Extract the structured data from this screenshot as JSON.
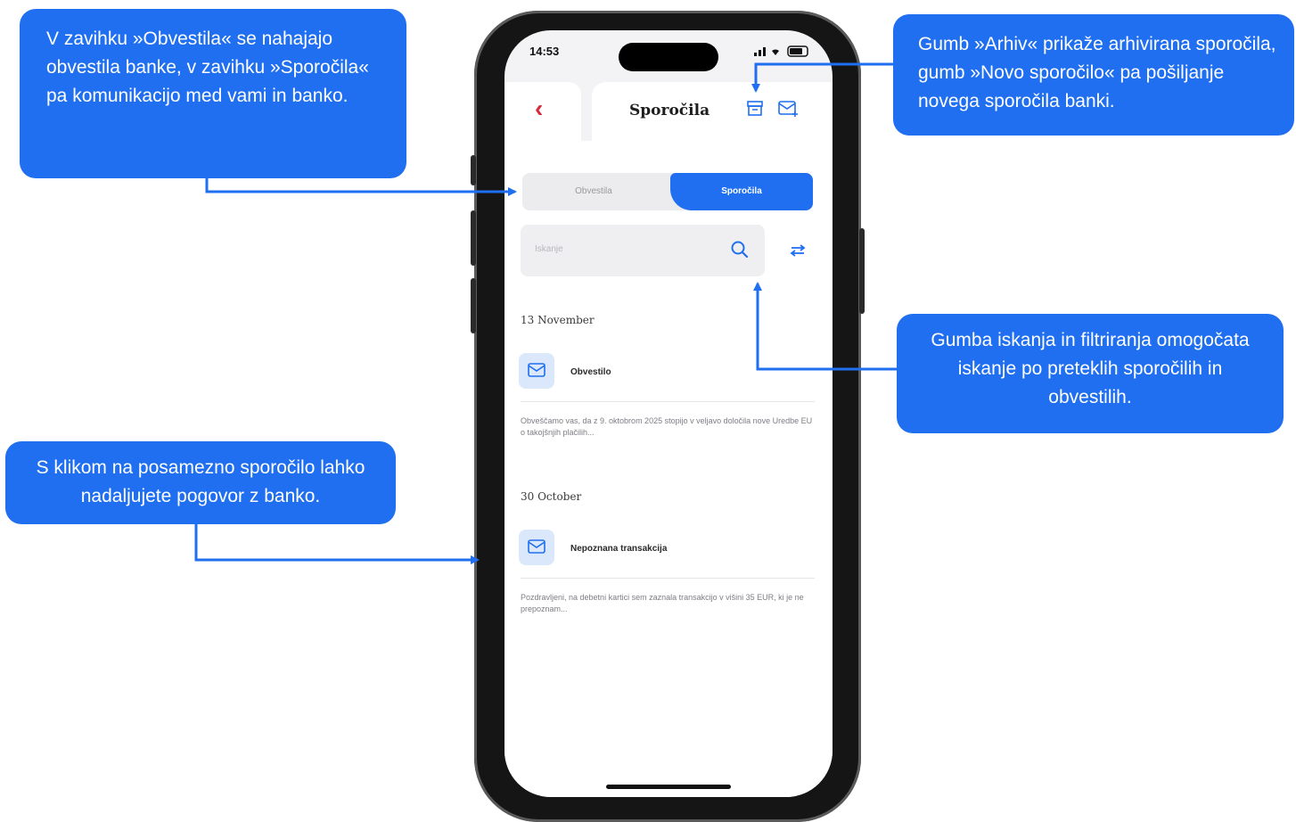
{
  "callouts": {
    "tabs": "V zavihku »Obvestila« se nahajajo obvestila banke, v zavihku »Sporočila«  pa komunikacijo med vami in banko.",
    "archive": "Gumb »Arhiv« prikaže arhivirana sporočila, gumb »Novo sporočilo« pa pošiljanje novega sporočila banki.",
    "search": "Gumba iskanja in filtriranja omogočata iskanje po preteklih sporočilih in obvestilih.",
    "message": "S klikom na posamezno sporočilo lahko nadaljujete pogovor z banko."
  },
  "phone": {
    "status": {
      "time": "14:53",
      "icons": "signal wifi battery"
    },
    "header": {
      "title": "Sporočila",
      "back_icon": "chevron-left-icon",
      "archive_icon": "archive-icon",
      "compose_icon": "compose-mail-icon"
    },
    "tabs": [
      {
        "label": "Obvestila",
        "active": false
      },
      {
        "label": "Sporočila",
        "active": true
      }
    ],
    "search": {
      "placeholder": "Iskanje"
    },
    "groups": [
      {
        "date": "13 November",
        "items": [
          {
            "title": "Obvestilo",
            "preview": "Obveščamo vas, da z 9. oktobrom 2025 stopijo v veljavo določila nove Uredbe EU o takojšnjih plačilih..."
          }
        ]
      },
      {
        "date": "30 October",
        "items": [
          {
            "title": "Nepoznana transakcija",
            "preview": "Pozdravljeni, na debetni kartici sem zaznala transakcijo v višini 35 EUR, ki je ne prepoznam..."
          }
        ]
      }
    ],
    "colors": {
      "accent": "#1f6ff0",
      "back": "#d9283a"
    }
  }
}
